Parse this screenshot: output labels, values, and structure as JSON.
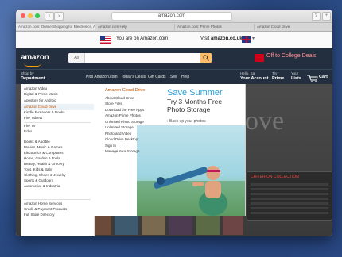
{
  "browser": {
    "url": "amazon.com",
    "tabs": [
      "Amazon.com: Online Shopping for Electronics, Apparel, Computers, Books...",
      "Amazon.com Help",
      "Amazon.com: Prime Photos",
      "Amazon Cloud Drive"
    ],
    "back_glyph": "‹",
    "forward_glyph": "›",
    "share_glyph": "⇪",
    "newtab_glyph": "+"
  },
  "notice": {
    "text": "You are on Amazon.com",
    "visit_prefix": "Visit",
    "visit_link": "amazon.co.uk"
  },
  "header": {
    "logo": "amazon",
    "search_category": "All",
    "search_value": "",
    "promo_text": "Off to College Deals"
  },
  "nav": {
    "shop_by_small": "Shop by",
    "shop_by_big": "Department",
    "links": [
      "Pit's Amazon.com",
      "Today's Deals",
      "Gift Cards",
      "Sell",
      "Help"
    ],
    "account_small": "Hello, Sa",
    "account_big": "Your Account",
    "prime_small": "Try",
    "prime_big": "Prime",
    "lists_small": "Your",
    "lists_big": "Lists",
    "cart": "Cart"
  },
  "menu": {
    "items": [
      "Amazon Video",
      "Digital & Prime Music",
      "Appstore for Android",
      "Amazon Cloud Drive",
      "Kindle E-readers & Books",
      "Fire Tablets",
      "Fire TV",
      "Echo",
      "Books & Audible",
      "Movies, Music & Games",
      "Electronics & Computers",
      "Home, Garden & Tools",
      "Beauty, Health & Grocery",
      "Toys, Kids & Baby",
      "Clothing, Shoes & Jewelry",
      "Sports & Outdoors",
      "Automotive & Industrial",
      "Amazon Home Services",
      "Credit & Payment Products",
      "Full Store Directory"
    ],
    "active_index": 3
  },
  "flyout": {
    "heading": "Amazon Cloud Drive",
    "items": [
      "About Cloud Drive",
      "Store Files",
      "Download the Free Apps",
      "Amazon Prime Photos",
      "Unlimited Photo Storage",
      "Unlimited Storage",
      "Photo and Video",
      "Cloud Drive Desktop",
      "Sign In",
      "Manage Your Storage"
    ],
    "promo_title": "Save Summer",
    "promo_line1": "Try 3 Months Free",
    "promo_line2": "Photo Storage",
    "promo_link": "› Back up your photos"
  },
  "page": {
    "hero_word": "ove",
    "ad_heading": "CRITERION COLLECTION"
  },
  "colors": {
    "accent_orange": "#c45500",
    "header_bg": "#232f3e",
    "promo_blue": "#2a9fd6"
  }
}
